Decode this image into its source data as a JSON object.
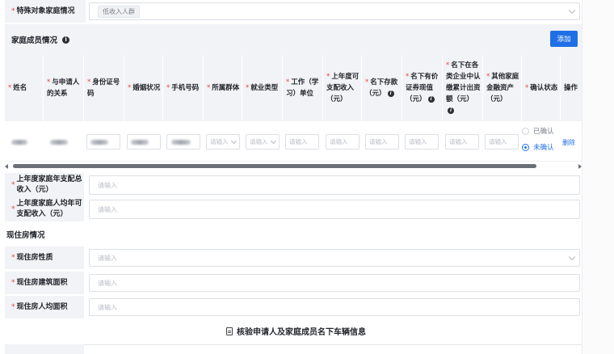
{
  "special_family": {
    "label": "特殊对象家庭情况",
    "tag": "低收入人群"
  },
  "family": {
    "title": "家庭成员情况",
    "add_label": "添加",
    "columns": [
      {
        "label": "姓名",
        "required": true
      },
      {
        "label": "与申请人的关系",
        "required": true
      },
      {
        "label": "身份证号码",
        "required": true
      },
      {
        "label": "婚姻状况",
        "required": true
      },
      {
        "label": "手机号码",
        "required": true
      },
      {
        "label": "所属群体",
        "required": true
      },
      {
        "label": "就业类型",
        "required": true
      },
      {
        "label": "工作（学习）单位",
        "required": true
      },
      {
        "label": "上年度可支配收入（元）",
        "required": true
      },
      {
        "label": "名下存款（元）",
        "required": true
      },
      {
        "label": "名下有价证券现值（元）",
        "required": true
      },
      {
        "label": "名下在各类企业中认缴累计出资额（元）",
        "required": true
      },
      {
        "label": "其他家庭金融资产（元）",
        "required": true
      },
      {
        "label": "确认状态",
        "required": true
      },
      {
        "label": "操作",
        "required": false
      }
    ],
    "row": {
      "placeholder_select": "请输入",
      "placeholder_input": "请输入",
      "confirm_options": [
        "已确认",
        "未确认"
      ],
      "confirm_selected": "未确认",
      "delete_label": "删除"
    }
  },
  "income": [
    {
      "label": "上年度家庭年支配总收入（元）",
      "placeholder": "请输入"
    },
    {
      "label": "上年度家庭人均年可支配收入（元）",
      "placeholder": "请输入"
    }
  ],
  "housing": {
    "title": "现住房情况",
    "fields": [
      {
        "label": "现住房性质",
        "placeholder": "请输入",
        "select": true
      },
      {
        "label": "现住房建筑面积",
        "placeholder": "请输入",
        "select": false
      },
      {
        "label": "现住房人均面积",
        "placeholder": "请输入",
        "select": false
      }
    ]
  },
  "vehicle_link": "核验申请人及家庭成员名下车辆信息"
}
